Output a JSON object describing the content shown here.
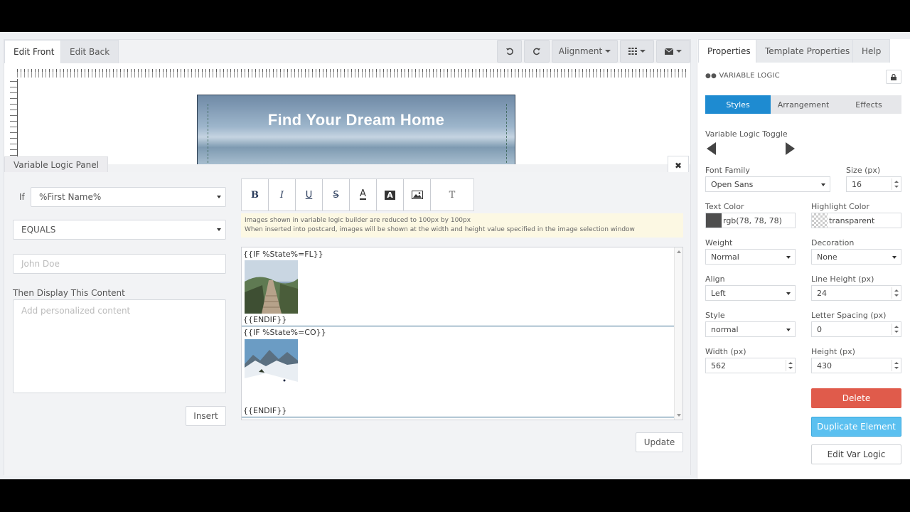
{
  "editor": {
    "tabs": [
      {
        "label": "Edit Front"
      },
      {
        "label": "Edit Back"
      }
    ],
    "toolbar": {
      "alignment_label": "Alignment"
    },
    "postcard": {
      "headline": "Find Your Dream Home"
    }
  },
  "logic_panel": {
    "title": "Variable Logic Panel",
    "if_label": "If",
    "variable_value": "%First Name%",
    "operator_value": "EQUALS",
    "compare_placeholder": "John Doe",
    "then_label": "Then Display This Content",
    "content_placeholder": "Add personalized content",
    "insert_label": "Insert",
    "update_label": "Update",
    "notice_line1": "Images shown in variable logic builder are reduced to 100px by 100px",
    "notice_line2": "When inserted into postcard, images will be shown at the width and height value specified in the image selection window",
    "blocks": [
      {
        "open": "{{IF %State%=FL}}",
        "close": "{{ENDIF}}",
        "image": "boardwalk-photo"
      },
      {
        "open": "{{IF %State%=CO}}",
        "close": "{{ENDIF}}",
        "image": "snow-mountain-photo"
      }
    ]
  },
  "properties": {
    "tabs": [
      {
        "label": "Properties"
      },
      {
        "label": "Template Properties"
      },
      {
        "label": "Help"
      }
    ],
    "element_title": "VARIABLE LOGIC",
    "segments": [
      "Styles",
      "Arrangement",
      "Effects"
    ],
    "toggle_label": "Variable Logic Toggle",
    "font_family": {
      "label": "Font Family",
      "value": "Open Sans"
    },
    "size": {
      "label": "Size (px)",
      "value": "16"
    },
    "text_color": {
      "label": "Text Color",
      "value": "rgb(78, 78, 78)",
      "swatch": "#4e4e4e"
    },
    "highlight_color": {
      "label": "Highlight Color",
      "value": "transparent"
    },
    "weight": {
      "label": "Weight",
      "value": "Normal"
    },
    "decoration": {
      "label": "Decoration",
      "value": "None"
    },
    "align": {
      "label": "Align",
      "value": "Left"
    },
    "line_height": {
      "label": "Line Height (px)",
      "value": "24"
    },
    "style": {
      "label": "Style",
      "value": "normal"
    },
    "letter_spacing": {
      "label": "Letter Spacing (px)",
      "value": "0"
    },
    "width": {
      "label": "Width (px)",
      "value": "562"
    },
    "height": {
      "label": "Height (px)",
      "value": "430"
    },
    "delete_label": "Delete",
    "duplicate_label": "Duplicate Element",
    "edit_logic_label": "Edit Var Logic"
  },
  "colors": {
    "accent": "#1e8bd1",
    "danger": "#e05b4b",
    "duplicate": "#5bc0f0"
  }
}
